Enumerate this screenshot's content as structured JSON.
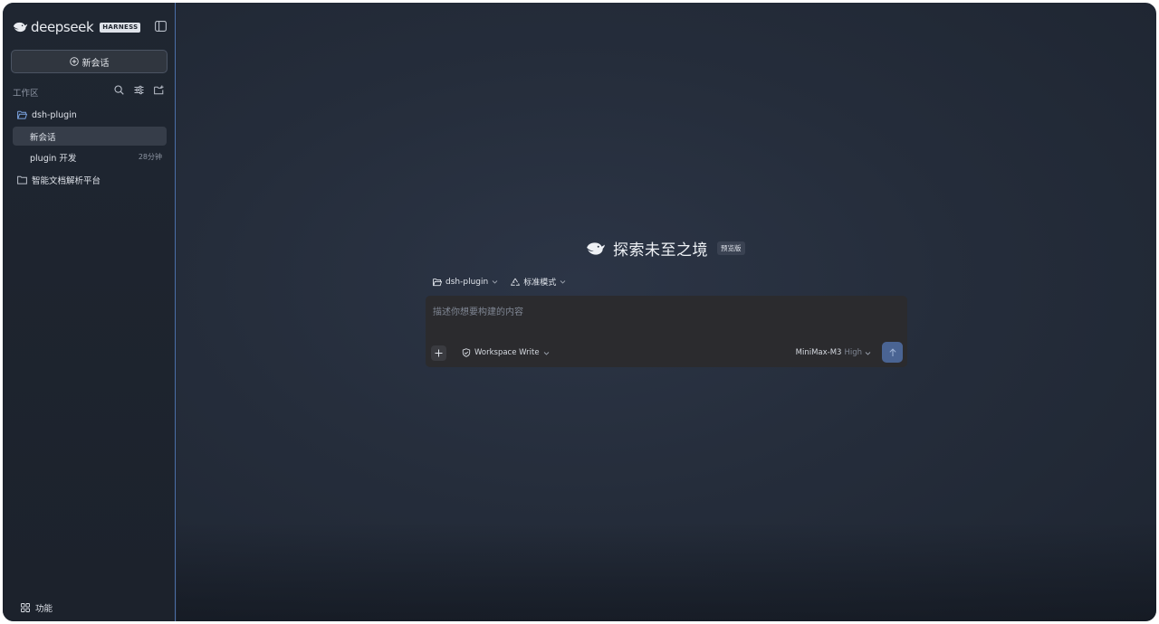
{
  "sidebar": {
    "brand": {
      "name": "deepseek",
      "badge": "HARNESS"
    },
    "new_chat_label": "新会话",
    "workspace_label": "工作区",
    "folders": [
      {
        "name": "dsh-plugin",
        "expanded": true
      },
      {
        "name": "智能文档解析平台",
        "expanded": false
      }
    ],
    "sessions": [
      {
        "title": "新会话",
        "time": "",
        "active": true
      },
      {
        "title": "plugin 开发",
        "time": "28分钟",
        "active": false
      }
    ],
    "footer_label": "功能"
  },
  "main": {
    "hero_title": "探索未至之境",
    "hero_badge": "预览版",
    "project_selector": "dsh-plugin",
    "mode_selector": "标准模式",
    "composer": {
      "placeholder": "描述你想要构建的内容",
      "value": "",
      "permission": "Workspace Write",
      "model": "MiniMax-M3",
      "effort": "High"
    }
  },
  "colors": {
    "background": "#252d3b",
    "sidebar": "#1e252f",
    "accent": "#4a6493",
    "divider": "#4b6fa8"
  }
}
